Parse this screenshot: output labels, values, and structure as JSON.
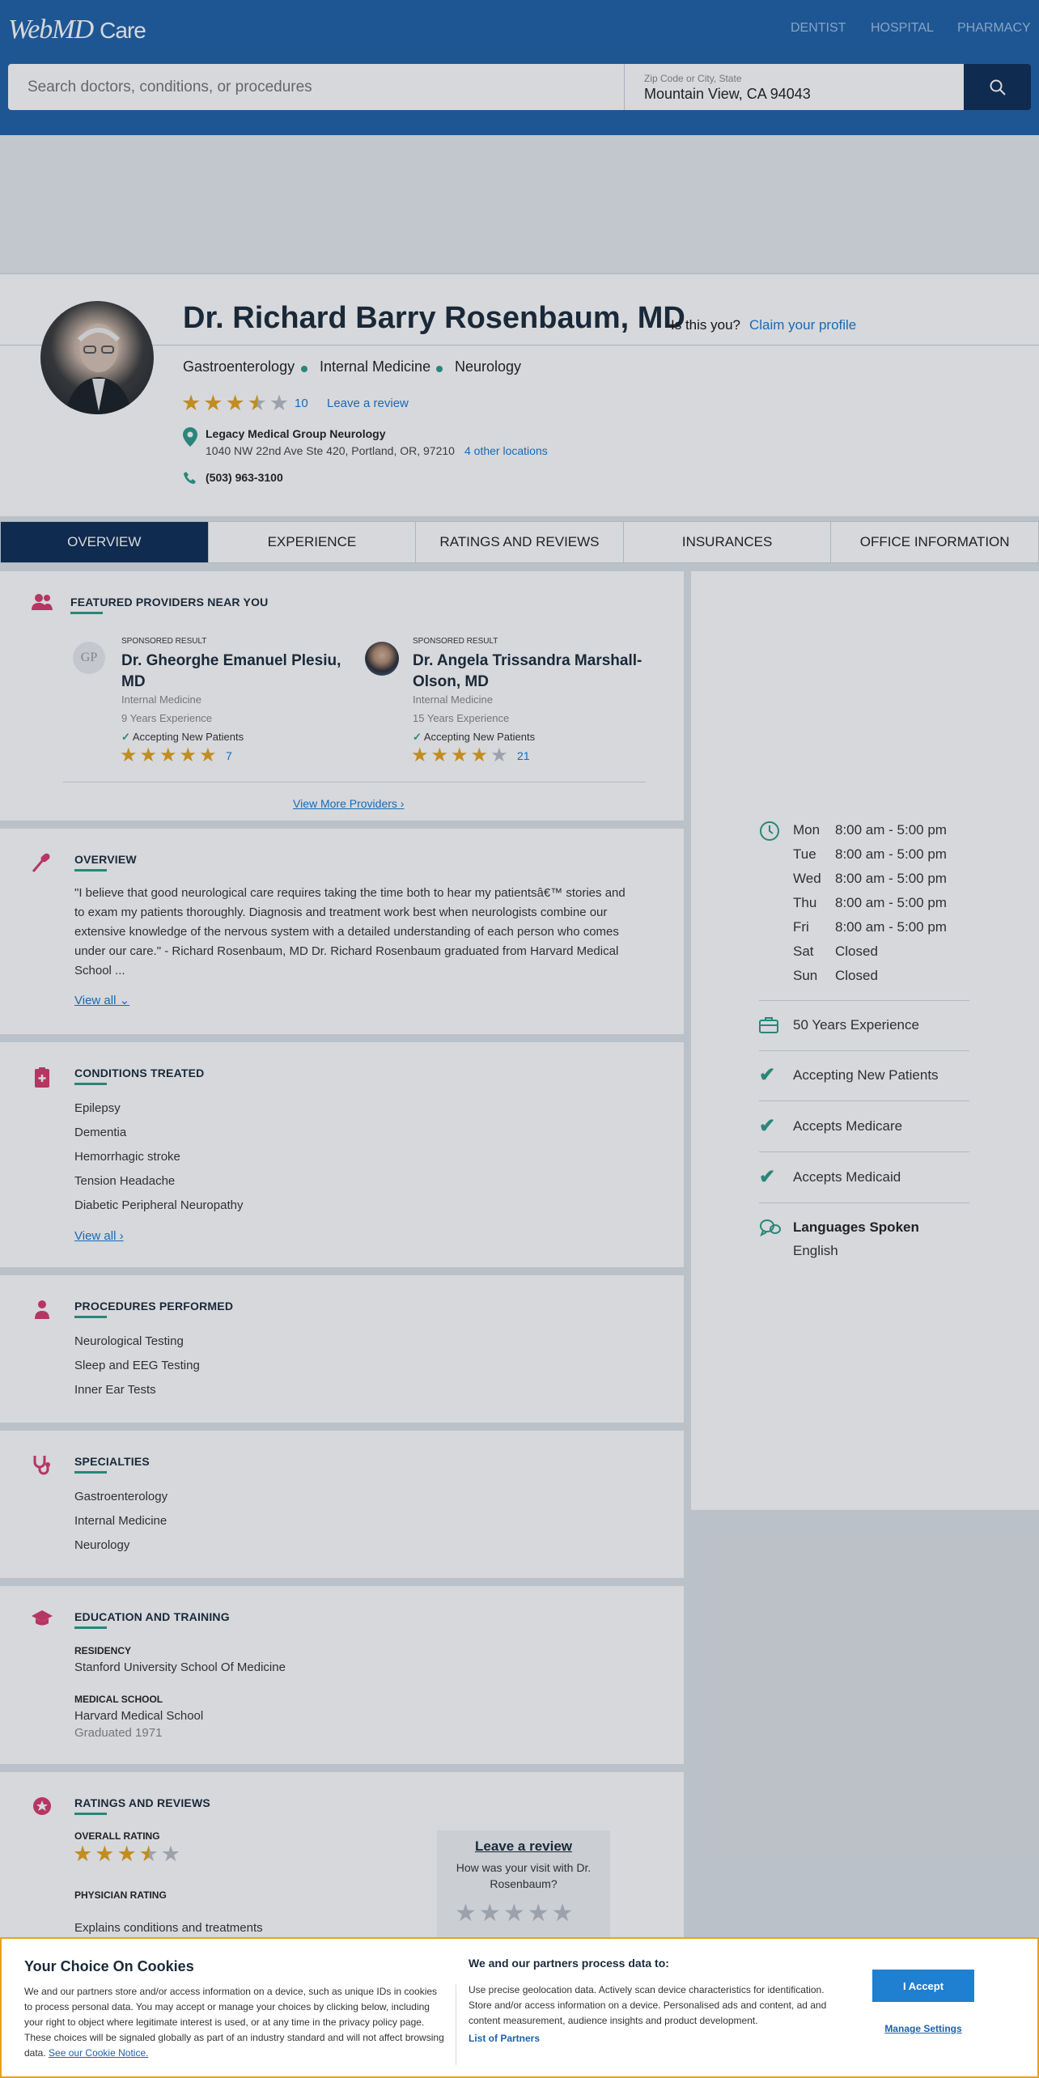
{
  "header": {
    "logo": "WebMD",
    "logo_suffix": "Care",
    "links": [
      "DENTIST",
      "HOSPITAL",
      "PHARMACY"
    ],
    "search_placeholder": "Search doctors, conditions, or procedures",
    "location_label": "Zip Code or City, State",
    "location_value": "Mountain View, CA 94043"
  },
  "profile": {
    "name": "Dr. Richard Barry Rosenbaum, MD",
    "is_this_you": "Is this you?",
    "claim": "Claim your profile",
    "specialties": [
      "Gastroenterology",
      "Internal Medicine",
      "Neurology"
    ],
    "rating": 3.5,
    "review_count": "10",
    "leave_review": "Leave a review",
    "location_name": "Legacy Medical Group Neurology",
    "address": "1040 NW 22nd Ave Ste 420, Portland, OR, 97210",
    "other_locations": "4 other locations",
    "phone": "(503) 963-3100"
  },
  "tabs": [
    "OVERVIEW",
    "EXPERIENCE",
    "RATINGS AND REVIEWS",
    "INSURANCES",
    "OFFICE INFORMATION"
  ],
  "featured": {
    "title": "FEATURED PROVIDERS NEAR YOU",
    "providers": [
      {
        "sponsored": "SPONSORED RESULT",
        "initials": "GP",
        "name": "Dr. Gheorghe Emanuel Plesiu, MD",
        "specialty": "Internal Medicine",
        "experience": "9 Years Experience",
        "accepting": "Accepting New Patients",
        "rating": 5,
        "reviews": "7"
      },
      {
        "sponsored": "SPONSORED RESULT",
        "name": "Dr. Angela Trissandra Marshall-Olson, MD",
        "specialty": "Internal Medicine",
        "experience": "15 Years Experience",
        "accepting": "Accepting New Patients",
        "rating": 4,
        "reviews": "21"
      }
    ],
    "view_more": "View More Providers"
  },
  "overview": {
    "title": "OVERVIEW",
    "text": "\"I believe that good neurological care requires taking the time both to hear my patientsâ€™ stories and to exam my patients thoroughly. Diagnosis and treatment work best when neurologists combine our extensive knowledge of the nervous system with a detailed understanding of each person who comes under our care.\" - Richard Rosenbaum, MD Dr. Richard Rosenbaum graduated from Harvard Medical School ...",
    "view_all": "View all"
  },
  "conditions": {
    "title": "CONDITIONS TREATED",
    "items": [
      "Epilepsy",
      "Dementia",
      "Hemorrhagic stroke",
      "Tension Headache",
      "Diabetic Peripheral Neuropathy"
    ],
    "view_all": "View all"
  },
  "procedures": {
    "title": "PROCEDURES PERFORMED",
    "items": [
      "Neurological Testing",
      "Sleep and EEG Testing",
      "Inner Ear Tests"
    ]
  },
  "specialties": {
    "title": "SPECIALTIES",
    "items": [
      "Gastroenterology",
      "Internal Medicine",
      "Neurology"
    ]
  },
  "education": {
    "title": "EDUCATION AND TRAINING",
    "residency_label": "RESIDENCY",
    "residency": "Stanford University School Of Medicine",
    "school_label": "MEDICAL SCHOOL",
    "school": "Harvard Medical School",
    "graduated": "Graduated 1971"
  },
  "ratings": {
    "title": "RATINGS AND REVIEWS",
    "overall_label": "OVERALL RATING",
    "overall": 3.5,
    "physician_label": "PHYSICIAN RATING",
    "explains": "Explains conditions and treatments",
    "leave_title": "Leave a review",
    "leave_question": "How was your visit with Dr. Rosenbaum?"
  },
  "office": {
    "hours": [
      {
        "day": "Mon",
        "time": "8:00 am - 5:00 pm"
      },
      {
        "day": "Tue",
        "time": "8:00 am - 5:00 pm"
      },
      {
        "day": "Wed",
        "time": "8:00 am - 5:00 pm"
      },
      {
        "day": "Thu",
        "time": "8:00 am - 5:00 pm"
      },
      {
        "day": "Fri",
        "time": "8:00 am - 5:00 pm"
      },
      {
        "day": "Sat",
        "time": "Closed"
      },
      {
        "day": "Sun",
        "time": "Closed"
      }
    ],
    "experience": "50 Years Experience",
    "accepting": "Accepting New Patients",
    "medicare": "Accepts Medicare",
    "medicaid": "Accepts Medicaid",
    "languages_label": "Languages Spoken",
    "language": "English"
  },
  "cookie": {
    "title": "Your Choice On Cookies",
    "body": "We and our partners store and/or access information on a device, such as unique IDs in cookies to process personal data. You may accept or manage your choices by clicking below, including your right to object where legitimate interest is used, or at any time in the privacy policy page. These choices will be signaled globally as part of an industry standard and will not affect browsing data.",
    "notice": "See our Cookie Notice.",
    "partners_title": "We and our partners process data to:",
    "partners_body": "Use precise geolocation data. Actively scan device characteristics for identification. Store and/or access information on a device. Personalised ads and content, ad and content measurement, audience insights and product development.",
    "list": "List of Partners",
    "accept": "I Accept",
    "manage": "Manage Settings"
  },
  "colors": {
    "brand": "#1f61a9",
    "accent": "#2e9c88",
    "star": "#e7a31a",
    "link": "#1779d3",
    "cookie_border": "#e7a31a"
  }
}
